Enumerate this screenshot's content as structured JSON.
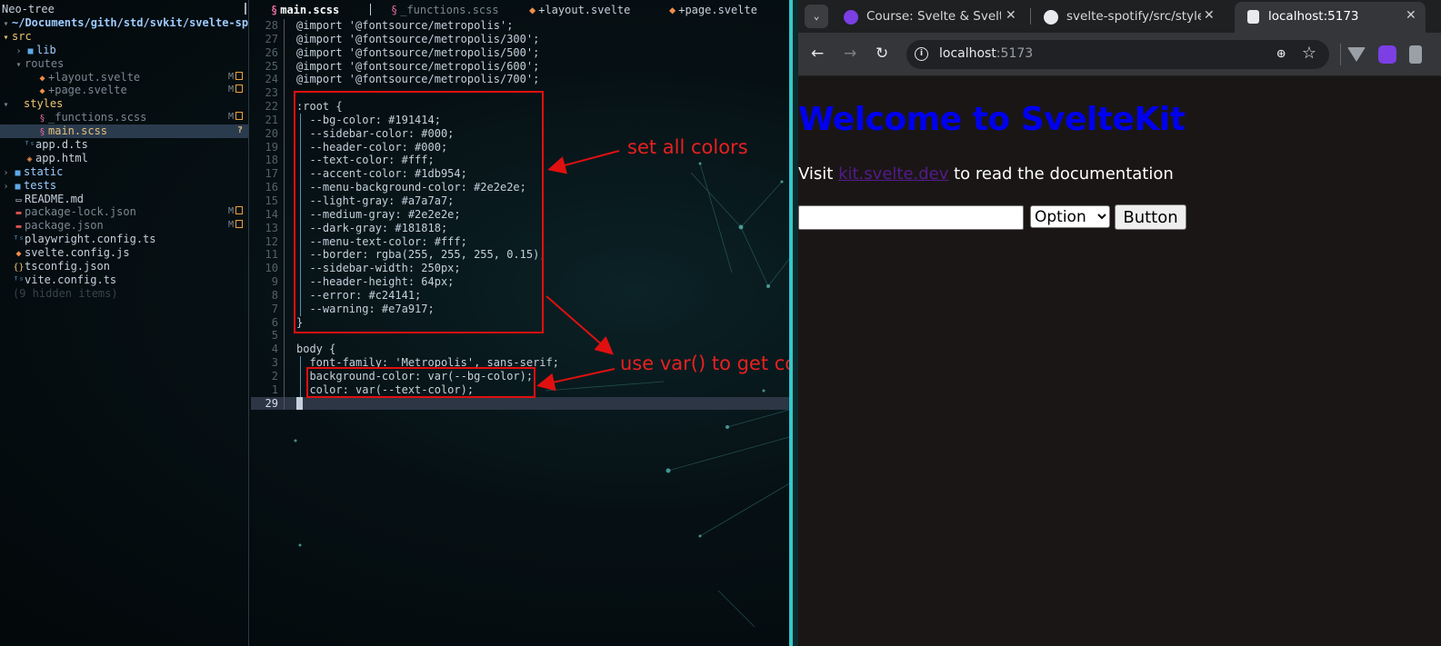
{
  "neotree": {
    "title": "Neo-tree",
    "root": "~/Documents/gith/std/svkit/svelte-spotify",
    "items": [
      {
        "label": "src",
        "icon": "folder-open-icon"
      },
      {
        "label": "lib",
        "icon": "folder-icon"
      },
      {
        "label": "routes",
        "icon": "folder-open-icon"
      },
      {
        "label": "+layout.svelte",
        "icon": "svelte-icon",
        "git": "M"
      },
      {
        "label": "+page.svelte",
        "icon": "svelte-icon",
        "git": "M"
      },
      {
        "label": "styles",
        "icon": "folder-open-icon"
      },
      {
        "label": "_functions.scss",
        "icon": "sass-icon",
        "git": "M"
      },
      {
        "label": "main.scss",
        "icon": "sass-icon",
        "git": "?"
      },
      {
        "label": "app.d.ts",
        "icon": "typescript-icon"
      },
      {
        "label": "app.html",
        "icon": "html-icon"
      },
      {
        "label": "static",
        "icon": "folder-icon"
      },
      {
        "label": "tests",
        "icon": "folder-icon"
      },
      {
        "label": "README.md",
        "icon": "markdown-icon"
      },
      {
        "label": "package-lock.json",
        "icon": "npm-icon",
        "git": "M"
      },
      {
        "label": "package.json",
        "icon": "npm-icon",
        "git": "M"
      },
      {
        "label": "playwright.config.ts",
        "icon": "typescript-icon"
      },
      {
        "label": "svelte.config.js",
        "icon": "svelte-icon"
      },
      {
        "label": "tsconfig.json",
        "icon": "json-icon"
      },
      {
        "label": "vite.config.ts",
        "icon": "typescript-icon"
      },
      {
        "label": "(9 hidden items)",
        "icon": ""
      }
    ]
  },
  "editor": {
    "tabs": [
      "main.scss",
      "_functions.scss",
      "+layout.svelte",
      "+page.svelte"
    ],
    "lines": [
      {
        "n": "28",
        "t": "@import '@fontsource/metropolis';"
      },
      {
        "n": "27",
        "t": "@import '@fontsource/metropolis/300';"
      },
      {
        "n": "26",
        "t": "@import '@fontsource/metropolis/500';"
      },
      {
        "n": "25",
        "t": "@import '@fontsource/metropolis/600';"
      },
      {
        "n": "24",
        "t": "@import '@fontsource/metropolis/700';"
      },
      {
        "n": "23",
        "t": ""
      },
      {
        "n": "22",
        "t": ":root {"
      },
      {
        "n": "21",
        "t": "  --bg-color: #191414;"
      },
      {
        "n": "20",
        "t": "  --sidebar-color: #000;"
      },
      {
        "n": "19",
        "t": "  --header-color: #000;"
      },
      {
        "n": "18",
        "t": "  --text-color: #fff;"
      },
      {
        "n": "17",
        "t": "  --accent-color: #1db954;"
      },
      {
        "n": "16",
        "t": "  --menu-background-color: #2e2e2e;"
      },
      {
        "n": "15",
        "t": "  --light-gray: #a7a7a7;"
      },
      {
        "n": "14",
        "t": "  --medium-gray: #2e2e2e;"
      },
      {
        "n": "13",
        "t": "  --dark-gray: #181818;"
      },
      {
        "n": "12",
        "t": "  --menu-text-color: #fff;"
      },
      {
        "n": "11",
        "t": "  --border: rgba(255, 255, 255, 0.15);"
      },
      {
        "n": "10",
        "t": "  --sidebar-width: 250px;"
      },
      {
        "n": "9",
        "t": "  --header-height: 64px;"
      },
      {
        "n": "8",
        "t": "  --error: #c24141;"
      },
      {
        "n": "7",
        "t": "  --warning: #e7a917;"
      },
      {
        "n": "6",
        "t": "}"
      },
      {
        "n": "5",
        "t": ""
      },
      {
        "n": "4",
        "t": "body {"
      },
      {
        "n": "3",
        "t": "  font-family: 'Metropolis', sans-serif;"
      },
      {
        "n": "2",
        "t": "  background-color: var(--bg-color);"
      },
      {
        "n": "1",
        "t": "  color: var(--text-color);"
      },
      {
        "n": "29",
        "t": "}"
      }
    ]
  },
  "annotations": {
    "set_colors": "set all colors",
    "use_var": "use var() to get color from"
  },
  "browser": {
    "tabs": [
      {
        "title": "Course: Svelte & SvelteKit",
        "favicon": "course-icon"
      },
      {
        "title": "svelte-spotify/src/styles",
        "favicon": "github-icon"
      },
      {
        "title": "localhost:5173",
        "favicon": "page-icon"
      }
    ],
    "url_host": "localhost",
    "url_port": ":5173",
    "page": {
      "heading": "Welcome to SvelteKit",
      "visit_prefix": "Visit ",
      "link_text": "kit.svelte.dev",
      "visit_suffix": " to read the documentation",
      "select_value": "Option",
      "button_label": "Button"
    }
  },
  "colors": {
    "heading": "#0000ee",
    "link": "#551a8b",
    "page_bg": "#1a1615",
    "annotation": "#e01010",
    "split_divider": "#35c8c8"
  }
}
